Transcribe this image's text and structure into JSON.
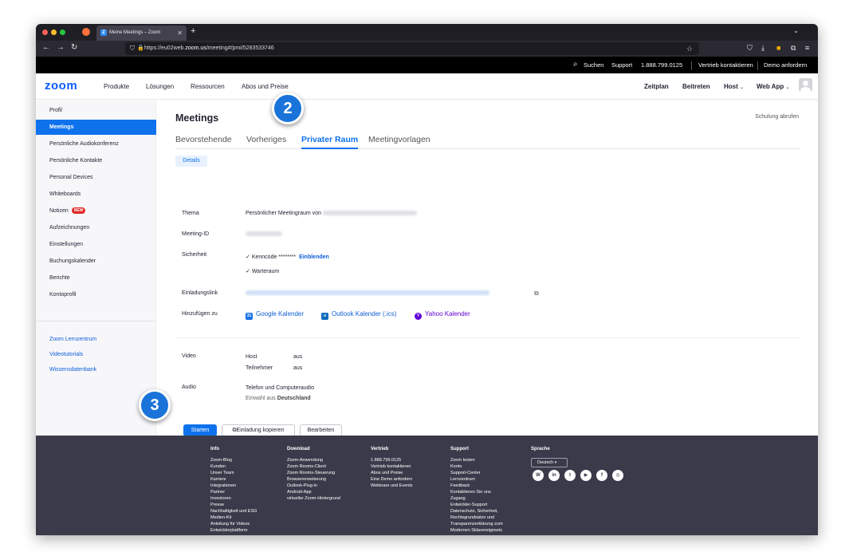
{
  "browser": {
    "tab_title": "Meine Meetings – Zoom",
    "url_prefix": "https://eu02web.",
    "url_domain": "zoom.us",
    "url_suffix": "/meeting#/pmi/5283533746"
  },
  "topbar": {
    "search": "Suchen",
    "support": "Support",
    "phone": "1.888.799.0125",
    "sales": "Vertrieb kontaktieren",
    "demo": "Demo anfordern"
  },
  "header": {
    "logo": "zoom",
    "nav": [
      "Produkte",
      "Lösungen",
      "Ressourcen",
      "Abos und Preise"
    ],
    "schedule": "Zeitplan",
    "join": "Beitreten",
    "host": "Host",
    "webapp": "Web App"
  },
  "sidebar": {
    "items": [
      "Profil",
      "Meetings",
      "Persönliche Audiokonferenz",
      "Persönliche Kontakte",
      "Personal Devices",
      "Whiteboards",
      "Notizen",
      "Aufzeichnungen",
      "Einstellungen",
      "Buchungskalender",
      "Berichte",
      "Kontoprofil"
    ],
    "new_badge": "NEW",
    "links": [
      "Zoom Lernzentrum",
      "Videotutorials",
      "Wissensdatenbank"
    ]
  },
  "main": {
    "title": "Meetings",
    "training": "Schulung abrufen",
    "tabs": [
      "Bevorstehende",
      "Vorheriges",
      "Privater Raum",
      "Meetingvorlagen"
    ],
    "subtab": "Details",
    "topic_label": "Thema",
    "topic_value": "Persönlicher Meetingraum von",
    "id_label": "Meeting-ID",
    "security_label": "Sicherheit",
    "passcode": "Kenncode",
    "passcode_mask": "********",
    "show": "Einblenden",
    "waiting_room": "Warteraum",
    "invite_label": "Einladungslink",
    "add_label": "Hinzufügen zu",
    "google": "Google Kalender",
    "outlook": "Outlook Kalender (.ics)",
    "yahoo": "Yahoo Kalender",
    "video_label": "Video",
    "host_label": "Host",
    "host_value": "aus",
    "participants_label": "Teilnehmer",
    "participants_value": "aus",
    "audio_label": "Audio",
    "audio_value": "Telefon und Computeraudio",
    "dialin_prefix": "Einwahl aus",
    "dialin_country": "Deutschland",
    "start": "Starten",
    "copy_invite": "Einladung kopieren",
    "edit": "Bearbeiten"
  },
  "badges": [
    "2",
    "3"
  ],
  "footer": {
    "columns": [
      {
        "heading": "Info",
        "items": [
          "Zoom-Blog",
          "Kunden",
          "Unser Team",
          "Karriere",
          "Integrationen",
          "Partner",
          "Investoren",
          "Presse",
          "Nachhaltigkeit und ESG",
          "Medien-Kit",
          "Anleitung für Videos",
          "Entwicklerplattform"
        ]
      },
      {
        "heading": "Download",
        "items": [
          "Zoom-Anwendung",
          "Zoom Rooms-Client",
          "Zoom Rooms-Steuerung",
          "Browsererweiterung",
          "Outlook-Plug-in",
          "Android-App",
          "virtueller Zoom-Hintergrund"
        ]
      },
      {
        "heading": "Vertrieb",
        "items": [
          "1.888.799.0125",
          "Vertrieb kontaktieren",
          "Abos und Preise",
          "Eine Demo anfordern",
          "Webinare und Events"
        ]
      },
      {
        "heading": "Support",
        "items": [
          "Zoom testen",
          "Konto",
          "Support-Center",
          "Lernzentrum",
          "Feedback",
          "Kontaktieren Sie uns",
          "Zugang",
          "Entwickler-Support",
          "Datenschutz, Sicherheit,",
          "Rechtsgrundsätze und",
          "Transparenzerklärung zum",
          "Modernen Sklavereigesetz"
        ]
      }
    ],
    "language_heading": "Sprache",
    "language_value": "Deutsch",
    "social": [
      "wordpress-icon",
      "linkedin-icon",
      "twitter-icon",
      "youtube-icon",
      "facebook-icon",
      "instagram-icon"
    ]
  }
}
